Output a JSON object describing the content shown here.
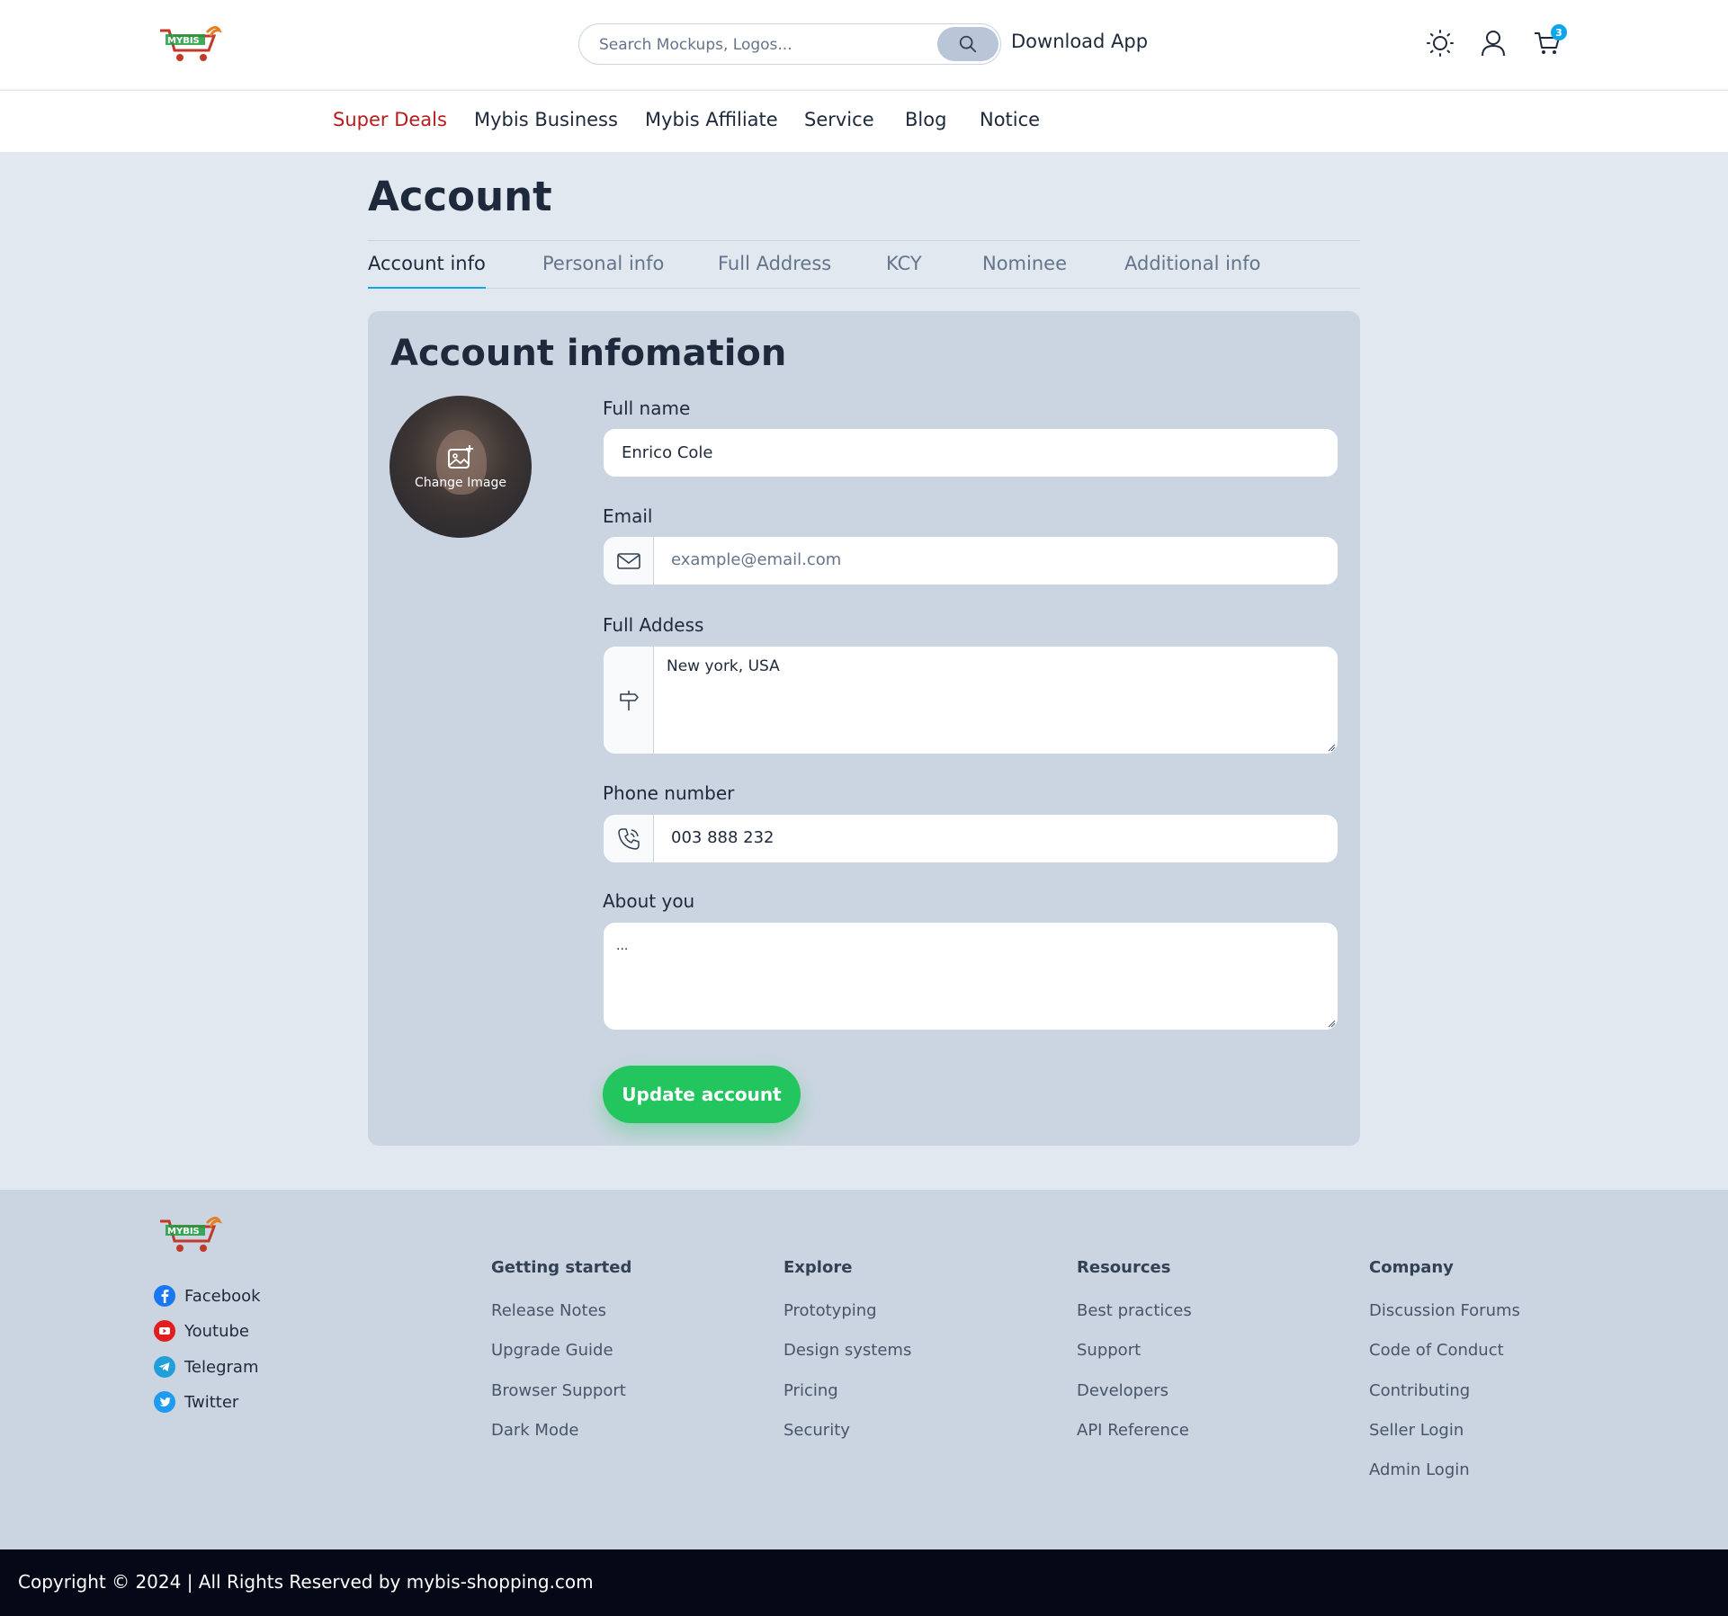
{
  "header": {
    "logo_alt": "MYBIS shopping logo",
    "search_placeholder": "Search Mockups, Logos...",
    "download_app": "Download App",
    "cart_count": "3"
  },
  "nav": {
    "items": [
      "Super Deals",
      "Mybis Business",
      "Mybis Affiliate",
      "Service",
      "Blog",
      "Notice"
    ],
    "active_color": "#b91c1c"
  },
  "account": {
    "title": "Account",
    "tabs": [
      "Account info",
      "Personal info",
      "Full Address",
      "KCY",
      "Nominee",
      "Additional info"
    ],
    "active_tab": "Account info",
    "card_title": "Account infomation",
    "change_image": "Change Image",
    "fields": {
      "full_name_label": "Full name",
      "full_name_value": "Enrico Cole",
      "email_label": "Email",
      "email_placeholder": "example@email.com",
      "address_label": "Full Addess",
      "address_value": "New york, USA",
      "phone_label": "Phone number",
      "phone_value": "003 888 232",
      "about_label": "About you",
      "about_value": "..."
    },
    "update_button": "Update account",
    "update_color": "#22c55e"
  },
  "footer": {
    "social": [
      {
        "label": "Facebook",
        "icon": "facebook-icon",
        "color": "#1877f2"
      },
      {
        "label": "Youtube",
        "icon": "youtube-icon",
        "color": "#e11d1d"
      },
      {
        "label": "Telegram",
        "icon": "telegram-icon",
        "color": "#229ed9"
      },
      {
        "label": "Twitter",
        "icon": "twitter-icon",
        "color": "#1d9bf0"
      }
    ],
    "columns": [
      {
        "title": "Getting started",
        "links": [
          "Release Notes",
          "Upgrade Guide",
          "Browser Support",
          "Dark Mode"
        ]
      },
      {
        "title": "Explore",
        "links": [
          "Prototyping",
          "Design systems",
          "Pricing",
          "Security"
        ]
      },
      {
        "title": "Resources",
        "links": [
          "Best practices",
          "Support",
          "Developers",
          "API Reference"
        ]
      },
      {
        "title": "Company",
        "links": [
          "Discussion Forums",
          "Code of Conduct",
          "Contributing",
          "Seller Login",
          "Admin Login"
        ]
      }
    ],
    "copyright": "Copyright © 2024 | All Rights Reserved by mybis-shopping.com"
  }
}
